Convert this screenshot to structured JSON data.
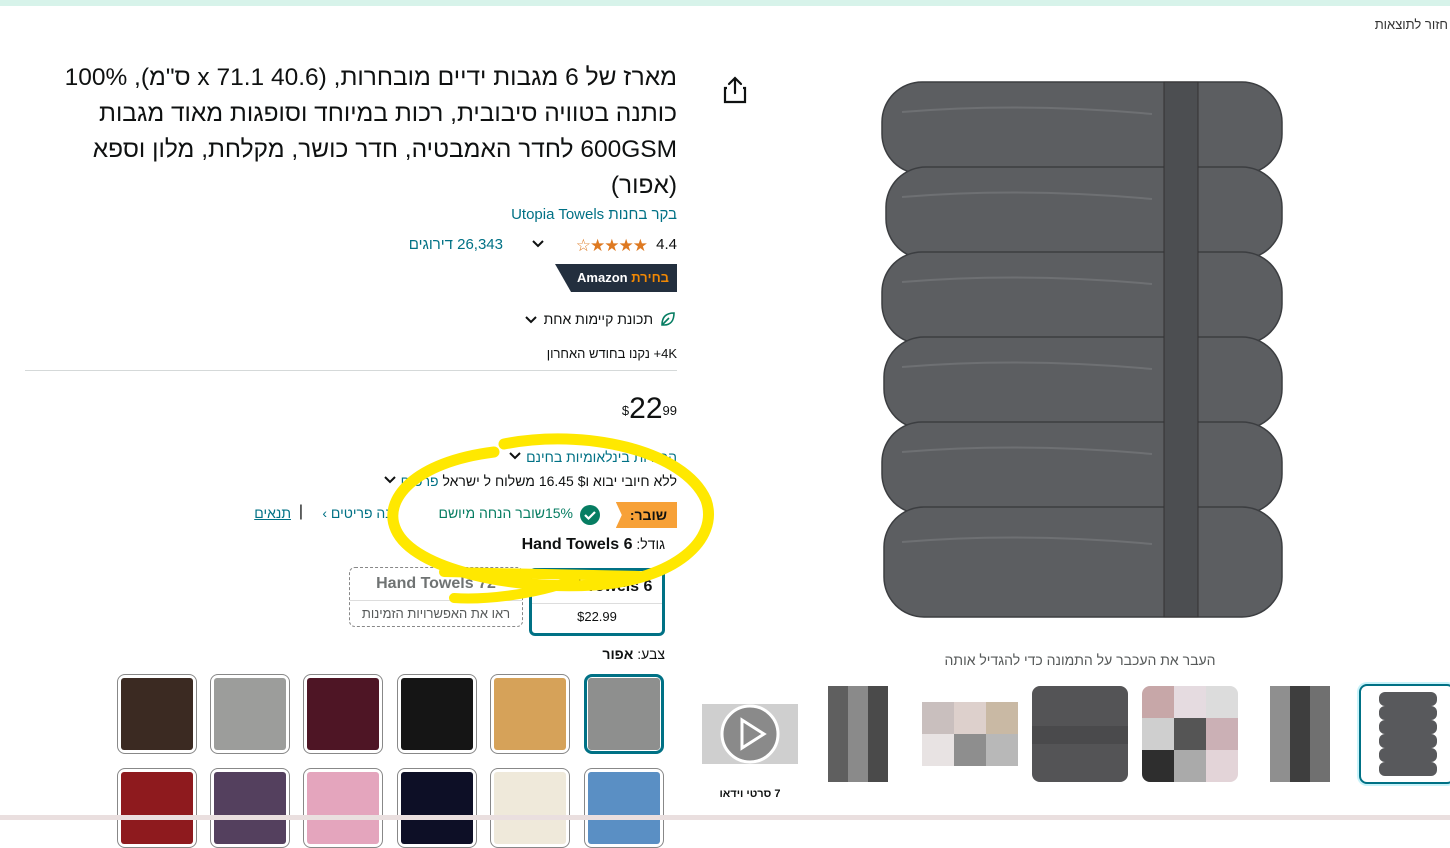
{
  "nav": {
    "back_to_results": "חזור לתוצאות"
  },
  "product": {
    "title": "מארז של 6 מגבות ידיים מובחרות, (40.6 x 71.1 ס\"מ), 100% כותנה בטוויה סיבובית, רכות במיוחד וסופגות מאוד מגבות 600GSM לחדר האמבטיה, חדר כושר, מקלחת, מלון וספא (אפור)",
    "store_link": "בקר בחנות Utopia Towels",
    "rating_score": "4.4",
    "rating_stars": 4.4,
    "rating_count": "26,343 דירוגים",
    "choice_badge_prefix": "בחירת",
    "choice_badge_brand": "Amazon",
    "sustainability": "תכונת קיימות אחת",
    "bought_recently": "4K+ נקנו בחודש האחרון",
    "price_symbol": "$",
    "price_whole": "22",
    "price_fraction": "99",
    "returns": "החזרות בינלאומיות בחינם",
    "shipping_text": "ללא חיובי יבוא ו$ 16.45 משלוח ל ישראל",
    "shipping_details": "פרטים",
    "coupon_badge": "שובר:",
    "coupon_text": "15%שובר הנחה מיושם",
    "coupon_shop": "קנה פריטים ›",
    "coupon_sep": "|",
    "coupon_terms": "תנאים"
  },
  "size": {
    "label": "גודל:",
    "selected": "6 Hand Towels",
    "options": [
      {
        "name": "6 Hand Towels",
        "sub": "$22.99"
      },
      {
        "name": "72 Hand Towels",
        "sub": "ראו את האפשרויות הזמינות"
      }
    ]
  },
  "color": {
    "label": "צבע:",
    "selected": "אפור",
    "swatches": [
      "#8e8f8e",
      "#d6a259",
      "#151515",
      "#4e1525",
      "#9c9d9b",
      "#3b2a22",
      "#5a8fc4",
      "#efe9da",
      "#0d0f26",
      "#e4a5bd",
      "#54405e",
      "#8e1a1e"
    ]
  },
  "gallery": {
    "hover_hint": "העבר את העכבר על התמונה כדי להגדיל אותה",
    "video_label": "7 סרטי וידאו"
  },
  "colors": {
    "link": "#007185",
    "star": "#de7921",
    "coupon": "#f7a138",
    "coupon_text": "#067d62",
    "annotation": "#ffe800",
    "towel": "#5c5e61"
  }
}
